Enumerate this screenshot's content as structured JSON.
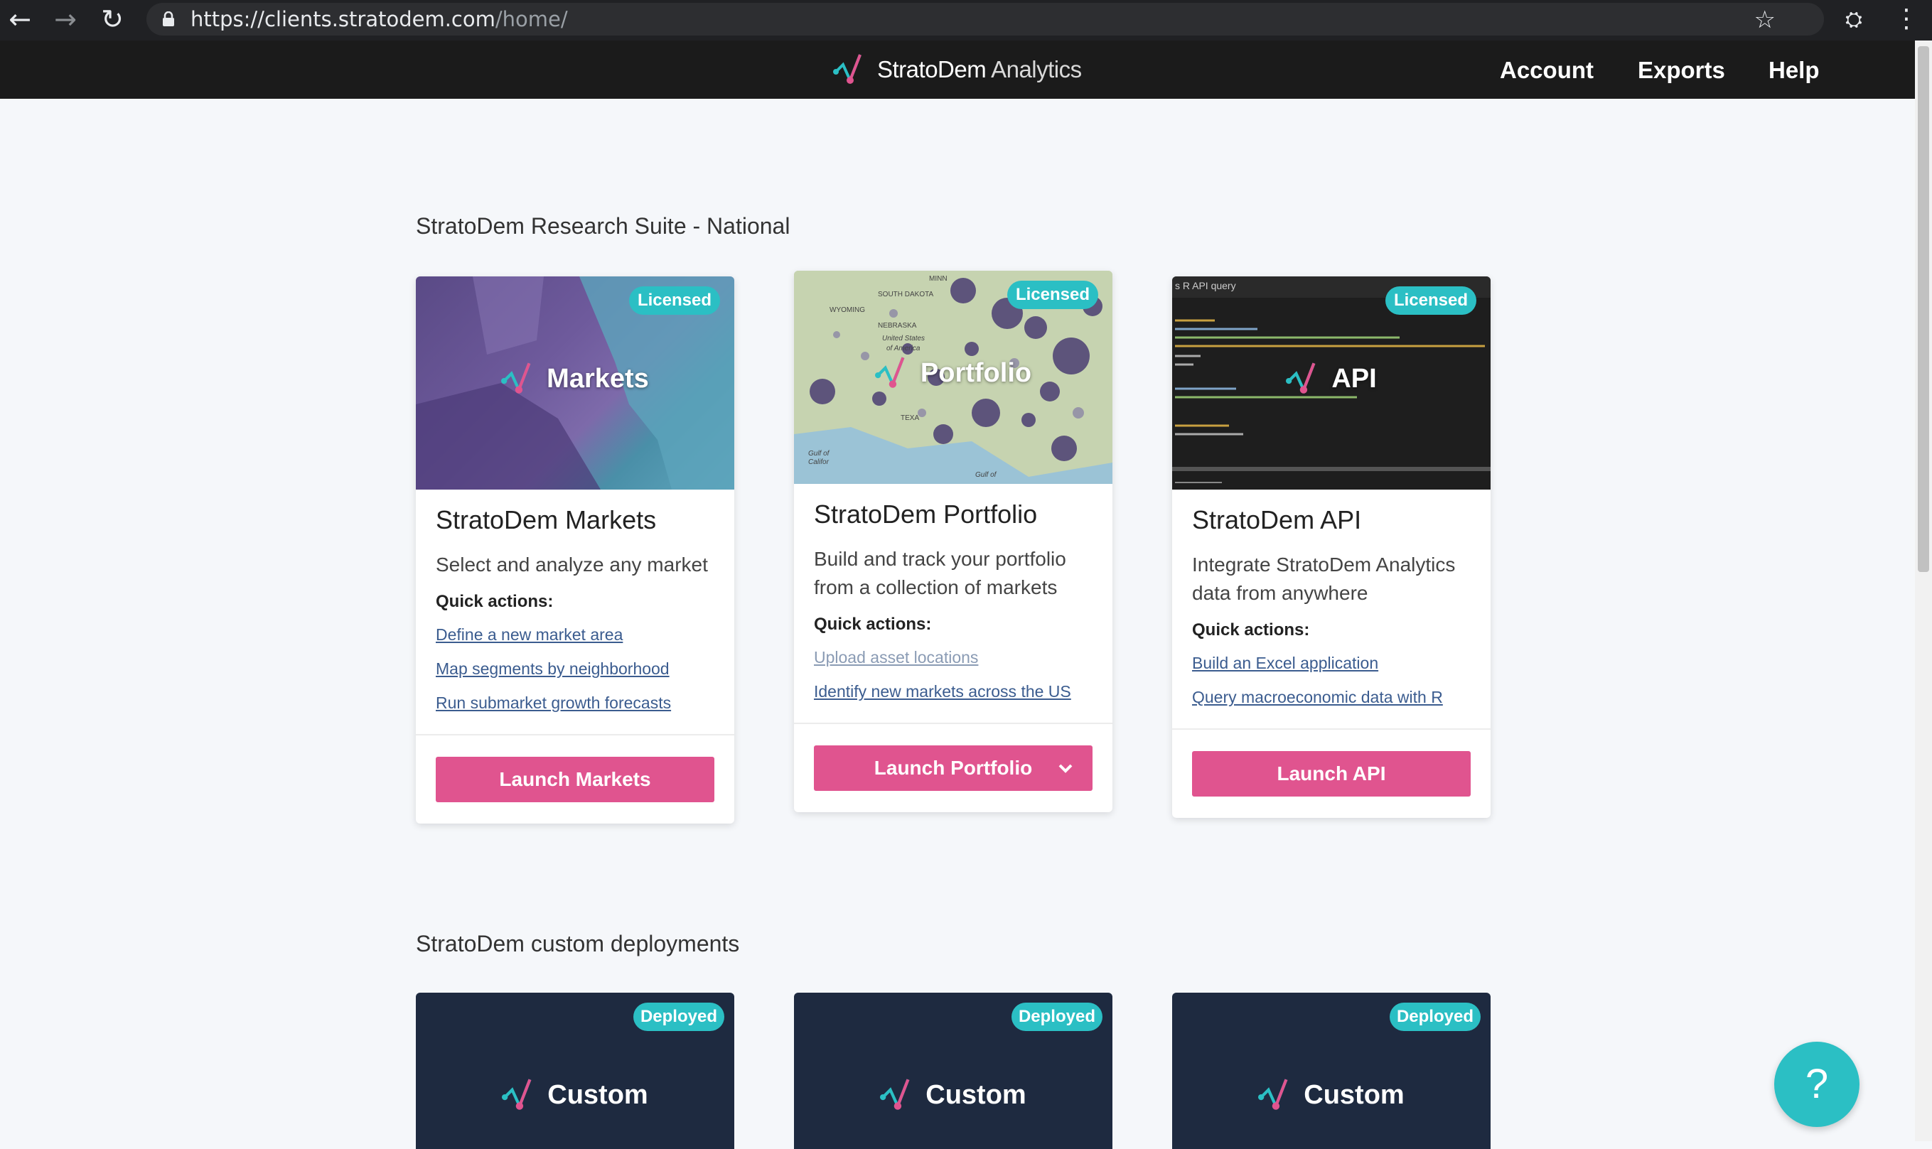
{
  "browser": {
    "url_host": "https://clients.stratodem.com",
    "url_path": "/home/"
  },
  "header": {
    "brand_name": "StratoDem",
    "brand_suffix": "Analytics",
    "nav": [
      "Account",
      "Exports",
      "Help"
    ]
  },
  "sections": [
    {
      "title": "StratoDem Research Suite - National"
    },
    {
      "title": "StratoDem custom deployments"
    }
  ],
  "products": [
    {
      "image_label": "Markets",
      "badge": "Licensed",
      "title_brand": "StratoDem",
      "title_rest": " Markets",
      "description": "Select and analyze any market",
      "quick_actions_label": "Quick actions:",
      "links": [
        "Define a new market area",
        "Map segments by neighborhood",
        "Run submarket growth forecasts"
      ],
      "button": "Launch Markets"
    },
    {
      "image_label": "Portfolio",
      "badge": "Licensed",
      "title_brand": "StratoDem",
      "title_rest": " Portfolio",
      "description": "Build and track your portfolio from a collection of markets",
      "quick_actions_label": "Quick actions:",
      "links": [
        "Upload asset locations",
        "Identify new markets across the US"
      ],
      "button": "Launch Portfolio",
      "map_labels": [
        "MINN",
        "SOUTH DAKOTA",
        "WYOMING",
        "NEBRASKA",
        "United States",
        "of America",
        "TEXA",
        "Gulf of",
        "Califor",
        "Gulf of"
      ]
    },
    {
      "image_label": "API",
      "badge": "Licensed",
      "title_brand": "StratoDem",
      "title_rest": " API",
      "description": "Integrate StratoDem Analytics data from anywhere",
      "quick_actions_label": "Quick actions:",
      "links": [
        "Build an Excel application",
        "Query macroeconomic data with R"
      ],
      "button": "Launch API",
      "code_header": "s R API query"
    }
  ],
  "deployments": [
    {
      "label": "Custom",
      "badge": "Deployed"
    },
    {
      "label": "Custom",
      "badge": "Deployed"
    },
    {
      "label": "Custom",
      "badge": "Deployed"
    }
  ],
  "help_button": "?",
  "colors": {
    "accent_pink": "#e0548f",
    "badge_teal": "#2bbfc4",
    "link_blue": "#3b5c8f",
    "deploy_navy": "#1e2a40"
  }
}
